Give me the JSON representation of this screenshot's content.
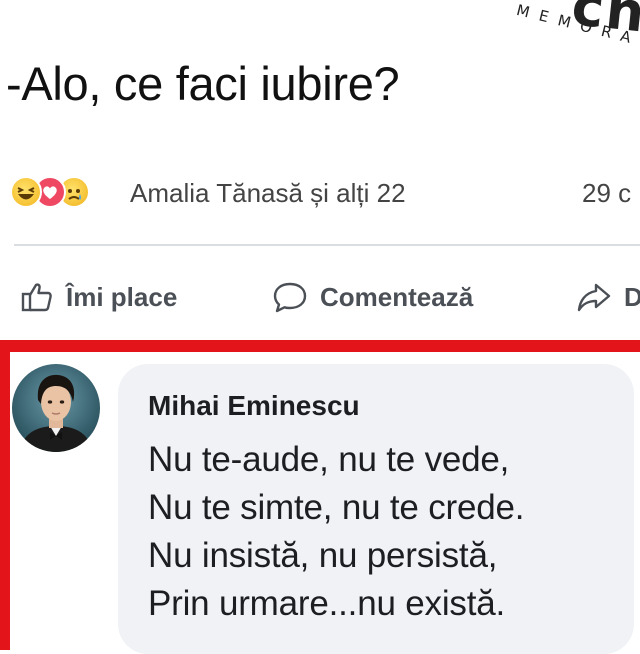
{
  "watermark": {
    "big": "ch",
    "small": "MEMORA"
  },
  "post": {
    "text": "-Alo, ce faci iubire?"
  },
  "reactions": {
    "icons": [
      "haha-reaction-icon",
      "love-reaction-icon",
      "sad-reaction-icon"
    ],
    "reactors_text": "Amalia Tănasă și alți 22",
    "comments_count": "29 c"
  },
  "actions": {
    "like_label": "Îmi place",
    "comment_label": "Comentează",
    "share_label": "D"
  },
  "comment": {
    "author": "Mihai Eminescu",
    "lines": [
      "Nu te-aude, nu te vede,",
      "Nu te simte, nu te crede.",
      "Nu insistă, nu persistă,",
      "Prin urmare...nu există."
    ]
  },
  "colors": {
    "highlight_border": "#e3151a",
    "bubble_bg": "#f0f2f5",
    "love": "#ef4863"
  }
}
